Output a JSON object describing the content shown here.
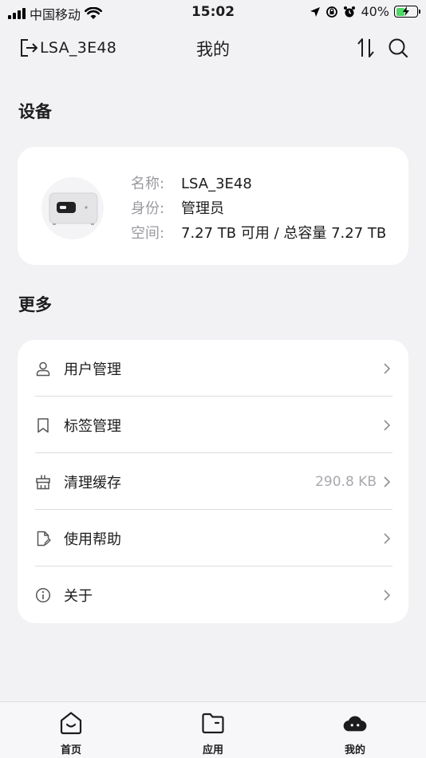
{
  "status_bar": {
    "carrier": "中国移动",
    "time": "15:02",
    "battery": "40%",
    "battery_level": 0.4
  },
  "nav": {
    "device_name": "LSA_3E48",
    "title": "我的"
  },
  "device_section": {
    "title": "设备",
    "name_key": "名称:",
    "name_val": "LSA_3E48",
    "role_key": "身份:",
    "role_val": "管理员",
    "space_key": "空间:",
    "space_val": "7.27 TB 可用 / 总容量 7.27 TB"
  },
  "more_section": {
    "title": "更多",
    "items": [
      {
        "label": "用户管理",
        "icon": "user-icon",
        "extra": ""
      },
      {
        "label": "标签管理",
        "icon": "bookmark-icon",
        "extra": ""
      },
      {
        "label": "清理缓存",
        "icon": "broom-icon",
        "extra": "290.8 KB"
      },
      {
        "label": "使用帮助",
        "icon": "help-doc-icon",
        "extra": ""
      },
      {
        "label": "关于",
        "icon": "info-icon",
        "extra": ""
      }
    ]
  },
  "tab_bar": {
    "tabs": [
      {
        "label": "首页",
        "icon": "home-icon"
      },
      {
        "label": "应用",
        "icon": "folder-icon"
      },
      {
        "label": "我的",
        "icon": "cloud-icon"
      }
    ]
  }
}
